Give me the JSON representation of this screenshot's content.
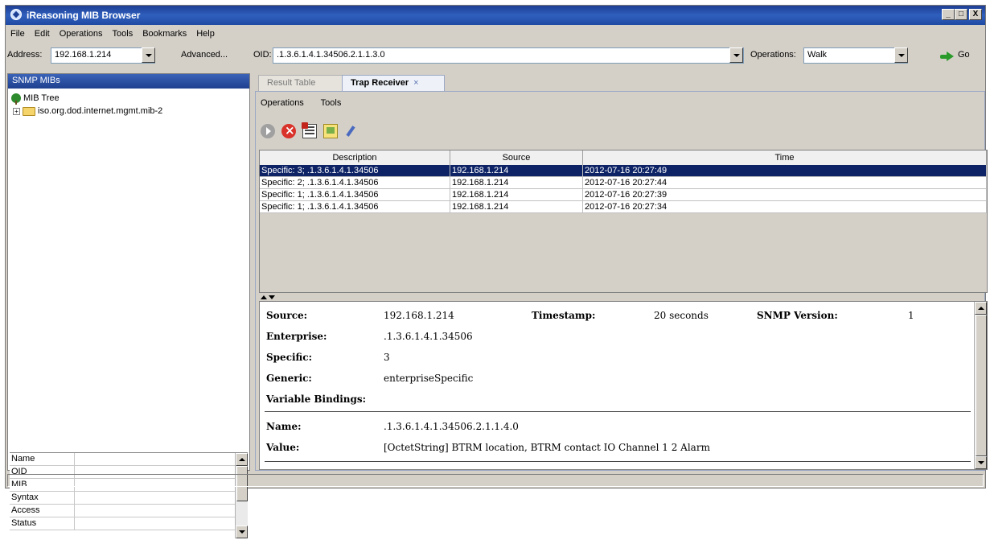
{
  "window": {
    "title": "iReasoning MIB Browser",
    "buttons": [
      "_",
      "□",
      "X"
    ]
  },
  "menu": [
    "File",
    "Edit",
    "Operations",
    "Tools",
    "Bookmarks",
    "Help"
  ],
  "address": {
    "label": "Address:",
    "value": "192.168.1.214",
    "advanced": "Advanced..."
  },
  "oid": {
    "label": "OID:",
    "value": ".1.3.6.1.4.1.34506.2.1.1.3.0"
  },
  "operations": {
    "label": "Operations:",
    "value": "Walk"
  },
  "go": {
    "label": "Go"
  },
  "left": {
    "header": "SNMP MIBs",
    "tree_root": "MIB Tree",
    "tree_child": "iso.org.dod.internet.mgmt.mib-2",
    "props": [
      "Name",
      "OID",
      "MIB",
      "Syntax",
      "Access",
      "Status"
    ]
  },
  "tabs": {
    "inactive": "Result Table",
    "active": "Trap Receiver",
    "close": "×"
  },
  "submenu": [
    "Operations",
    "Tools"
  ],
  "table": {
    "headers": [
      "Description",
      "Source",
      "Time"
    ],
    "rows": [
      {
        "desc": "Specific: 3; .1.3.6.1.4.1.34506",
        "source": "192.168.1.214",
        "time": "2012-07-16 20:27:49"
      },
      {
        "desc": "Specific: 2; .1.3.6.1.4.1.34506",
        "source": "192.168.1.214",
        "time": "2012-07-16 20:27:44"
      },
      {
        "desc": "Specific: 1; .1.3.6.1.4.1.34506",
        "source": "192.168.1.214",
        "time": "2012-07-16 20:27:39"
      },
      {
        "desc": "Specific: 1; .1.3.6.1.4.1.34506",
        "source": "192.168.1.214",
        "time": "2012-07-16 20:27:34"
      }
    ]
  },
  "detail": {
    "source_label": "Source:",
    "source": "192.168.1.214",
    "timestamp_label": "Timestamp:",
    "timestamp": "20 seconds",
    "version_label": "SNMP Version:",
    "version": "1",
    "enterprise_label": "Enterprise:",
    "enterprise": ".1.3.6.1.4.1.34506",
    "specific_label": "Specific:",
    "specific": "3",
    "generic_label": "Generic:",
    "generic": "enterpriseSpecific",
    "varbind_label": "Variable Bindings:",
    "name_label": "Name:",
    "name": ".1.3.6.1.4.1.34506.2.1.1.4.0",
    "value_label": "Value:",
    "value": "[OctetString] BTRM location, BTRM contact IO Channel 1 2 Alarm"
  }
}
